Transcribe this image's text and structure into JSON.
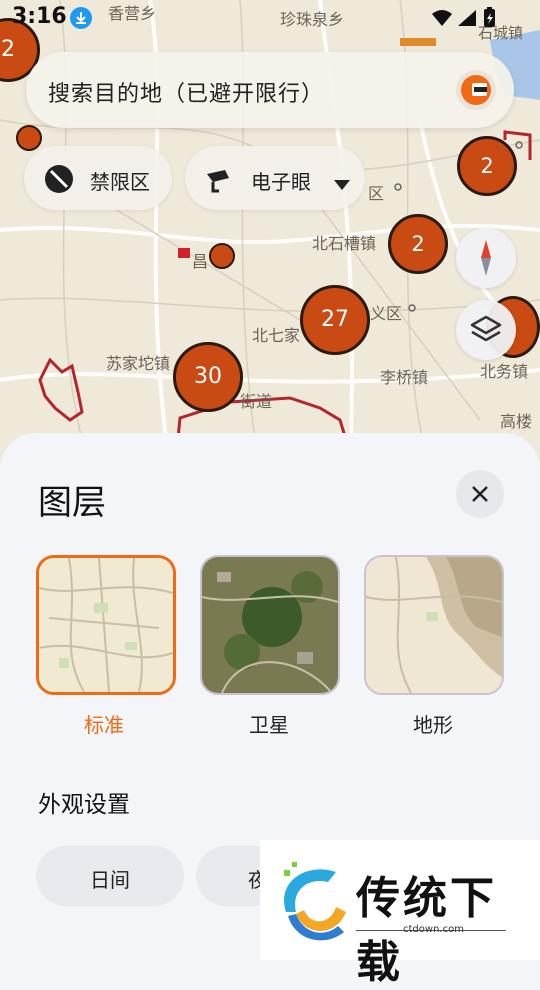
{
  "status_bar": {
    "time": "3:16"
  },
  "map": {
    "labels": [
      "香营乡",
      "珍珠泉乡",
      "石城镇",
      "北石槽镇",
      "北七家",
      "苏家坨镇",
      "李桥镇",
      "北务镇",
      "高楼",
      "昌",
      "区",
      "义区",
      "街道"
    ],
    "clusters": [
      "2",
      "2",
      "2",
      "27",
      "30"
    ]
  },
  "search": {
    "placeholder": "搜索目的地（已避开限行）"
  },
  "chips": {
    "restricted": "禁限区",
    "cameras": "电子眼"
  },
  "layers_sheet": {
    "title": "图层",
    "types": [
      {
        "label": "标准",
        "selected": true
      },
      {
        "label": "卫星",
        "selected": false
      },
      {
        "label": "地形",
        "selected": false
      }
    ],
    "appearance_title": "外观设置",
    "appearance_options": [
      "日间",
      "夜"
    ]
  },
  "watermark": {
    "brand": "传统下载",
    "url": "ctdown.com"
  },
  "colors": {
    "accent": "#f06a13",
    "cluster": "#c94a12"
  }
}
